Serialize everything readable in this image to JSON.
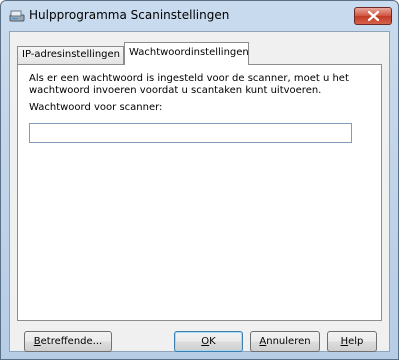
{
  "window": {
    "title": "Hulpprogramma Scaninstellingen",
    "icon": "scanner-icon",
    "close_icon": "close-icon"
  },
  "tabs": [
    {
      "label": "IP-adresinstellingen",
      "active": false
    },
    {
      "label": "Wachtwoordinstellingen",
      "active": true
    }
  ],
  "panel": {
    "description": "Als er een wachtwoord is ingesteld voor de scanner, moet u het wachtwoord invoeren voordat u scantaken kunt uitvoeren.",
    "field_label": "Wachtwoord voor scanner:",
    "password_value": ""
  },
  "buttons": {
    "about": {
      "mnemonic": "B",
      "rest": "etreffende..."
    },
    "ok": {
      "mnemonic": "O",
      "rest": "K"
    },
    "cancel": {
      "mnemonic": "A",
      "rest": "nnuleren"
    },
    "help": {
      "mnemonic": "H",
      "rest": "elp"
    }
  },
  "colors": {
    "close_button": "#c9412b",
    "default_button_border": "#3c7fb1"
  }
}
